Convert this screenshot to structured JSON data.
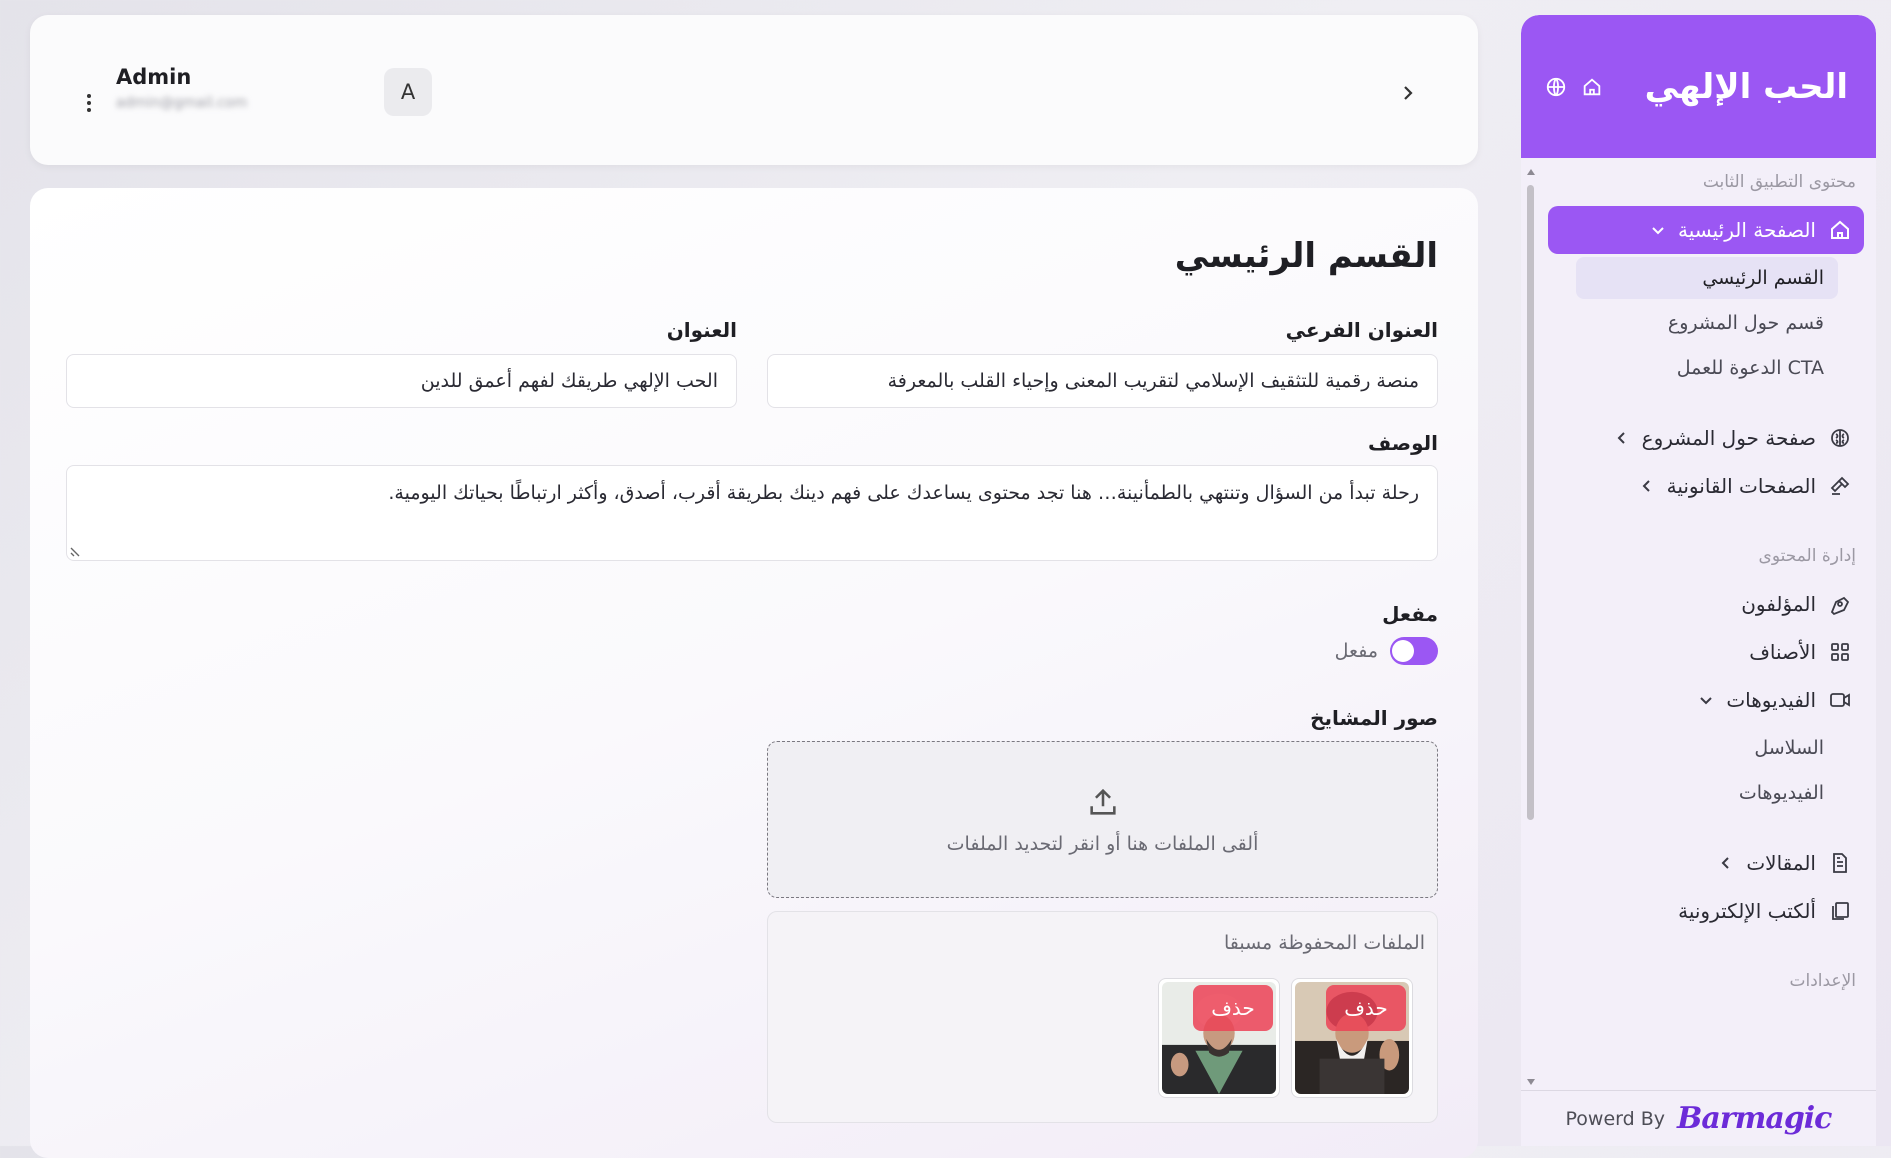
{
  "brand": {
    "title": "الحب الإلهي",
    "globe_icon": "globe-icon",
    "home_icon": "home-icon"
  },
  "sidebar": {
    "section_static": "محتوى التطبيق الثابت",
    "home_page": "الصفحة الرئيسية",
    "home_sub": [
      "القسم الرئيسي",
      "قسم حول المشروع",
      "CTA الدعوة للعمل"
    ],
    "about_page": "صفحة حول المشروع",
    "legal_pages": "الصفحات القانونية",
    "section_content": "إدارة المحتوى",
    "authors": "المؤلفون",
    "categories": "الأصناف",
    "videos": "الفيديوهات",
    "videos_sub": [
      "السلاسل",
      "الفيديوهات"
    ],
    "articles": "المقالات",
    "ebooks": "ألكتب الإلكترونية",
    "section_settings": "الإعدادات",
    "powered_by": "Powerd By",
    "powered_logo": "Barmagic"
  },
  "header": {
    "avatar_letter": "A",
    "user_name": "Admin",
    "user_email": "admin@gmail.com"
  },
  "form": {
    "page_title": "القسم الرئيسي",
    "subtitle_label": "العنوان الفرعي",
    "subtitle_value": "منصة رقمية للتثقيف الإسلامي لتقريب المعنى وإحياء القلب بالمعرفة",
    "title_label": "العنوان",
    "title_value": "الحب الإلهي طريقك لفهم أعمق للدين",
    "description_label": "الوصف",
    "description_value": "رحلة تبدأ من السؤال وتنتهي بالطمأنينة… هنا تجد محتوى يساعدك على فهم دينك بطريقة أقرب، أصدق، وأكثر ارتباطًا بحياتك اليومية.",
    "enabled_label": "مفعل",
    "enabled_toggle_text": "مفعل",
    "enabled": true,
    "images_label": "صور المشايخ",
    "dropzone_text": "ألقى الملفات هنا أو انقر لتحديد الملفات",
    "saved_files_title": "الملفات المحفوظة مسبقا",
    "delete_label": "حذف"
  },
  "colors": {
    "accent": "#9b57f3",
    "delete": "#ec4256"
  }
}
